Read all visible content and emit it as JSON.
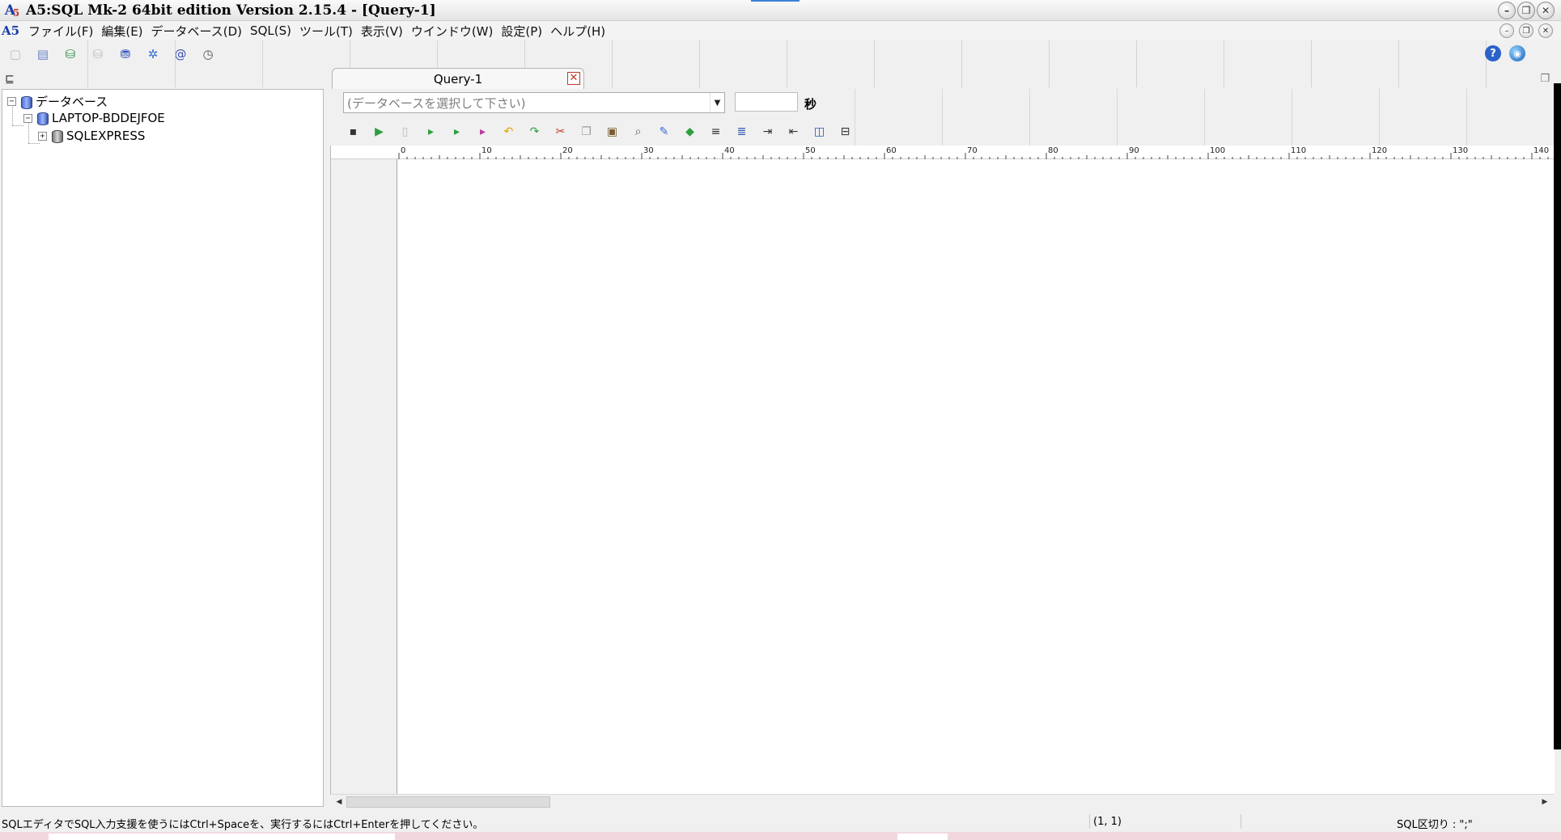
{
  "window": {
    "title": "A5:SQL Mk-2 64bit edition Version 2.15.4 - [Query-1]",
    "accent": "#3c7fd8"
  },
  "menu": {
    "items": [
      "ファイル(F)",
      "編集(E)",
      "データベース(D)",
      "SQL(S)",
      "ツール(T)",
      "表示(V)",
      "ウインドウ(W)",
      "設定(P)",
      "ヘルプ(H)"
    ]
  },
  "toolbar": {
    "icons": [
      "new-icon",
      "open-icon",
      "connect-icon",
      "disconnect-icon",
      "database-icon",
      "settings-icon",
      "mail-icon",
      "clock-icon"
    ],
    "right_icons": [
      "help-icon",
      "web-icon"
    ]
  },
  "tree": {
    "root": "データベース",
    "host": "LAPTOP-BDDEJFOE",
    "instance": "SQLEXPRESS",
    "root_expander": "−",
    "host_expander": "−",
    "instance_expander": "+"
  },
  "tab": {
    "label": "Query-1",
    "close": "✕"
  },
  "query_toolbar": {
    "db_placeholder": "(データベースを選択して下さい)",
    "timeout_value": "",
    "timeout_unit": "秒"
  },
  "ruler": {
    "labels": [
      "0",
      "10",
      "20",
      "30",
      "40",
      "50",
      "60",
      "70",
      "80",
      "90",
      "100",
      "110",
      "120",
      "130",
      "140"
    ]
  },
  "status": {
    "message": "SQLエディタでSQL入力支援を使うにはCtrl+Spaceを、実行するにはCtrl+Enterを押してください。",
    "position": "(1, 1)",
    "delimiter": "SQL区切り : \";\""
  }
}
